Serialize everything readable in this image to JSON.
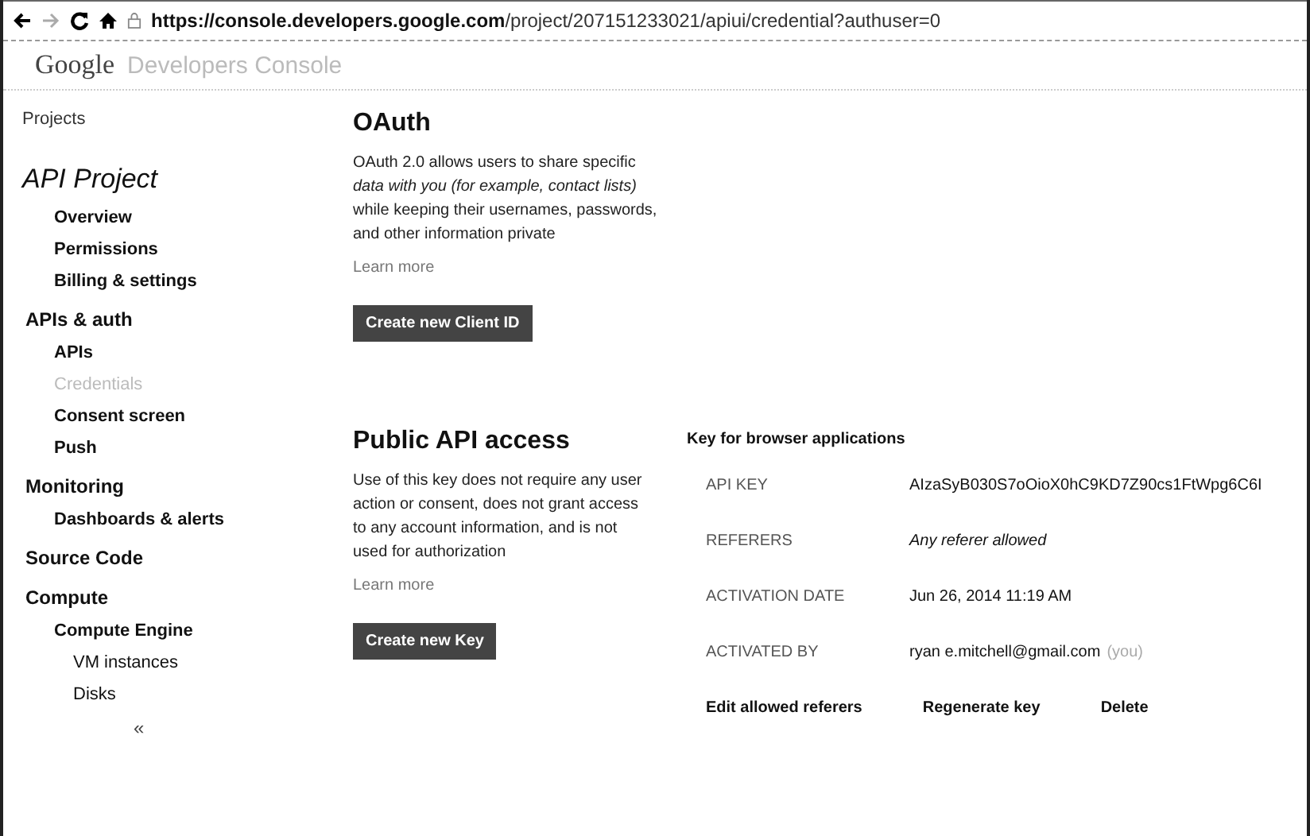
{
  "browser": {
    "url_host": "https://console.developers.google.com",
    "url_path": "/project/207151233021/apiui/credential?authuser=0"
  },
  "header": {
    "logo": "Google",
    "product": "Developers Console"
  },
  "sidebar": {
    "back_link": "Projects",
    "project": "API Project",
    "items": [
      {
        "label": "Overview",
        "kind": "item",
        "selected": false
      },
      {
        "label": "Permissions",
        "kind": "item",
        "selected": false
      },
      {
        "label": "Billing & settings",
        "kind": "item",
        "selected": false
      },
      {
        "label": "APIs & auth",
        "kind": "section",
        "selected": false
      },
      {
        "label": "APIs",
        "kind": "item",
        "selected": false
      },
      {
        "label": "Credentials",
        "kind": "item",
        "selected": true
      },
      {
        "label": "Consent screen",
        "kind": "item",
        "selected": false
      },
      {
        "label": "Push",
        "kind": "item",
        "selected": false
      },
      {
        "label": "Monitoring",
        "kind": "section",
        "selected": false
      },
      {
        "label": "Dashboards & alerts",
        "kind": "item",
        "selected": false
      },
      {
        "label": "Source Code",
        "kind": "section",
        "selected": false
      },
      {
        "label": "Compute",
        "kind": "section",
        "selected": false
      },
      {
        "label": "Compute Engine",
        "kind": "item",
        "selected": false
      },
      {
        "label": "VM instances",
        "kind": "subitem",
        "selected": false
      },
      {
        "label": "Disks",
        "kind": "subitem",
        "selected": false
      }
    ],
    "collapse": "«"
  },
  "oauth": {
    "title": "OAuth",
    "description": "OAuth 2.0 allows users to share specific *data with you (for example, contact lists)* while keeping their usernames, passwords, and other information private",
    "learn_more": "Learn more",
    "button": "Create new Client ID"
  },
  "public_api": {
    "title": "Public API access",
    "description": "Use of this key does not require any user action or consent, does not grant access to any account information, and is not used for authorization",
    "learn_more": "Learn more",
    "button": "Create new Key"
  },
  "key_card": {
    "title": "Key for browser applications",
    "fields": [
      {
        "label": "API KEY",
        "value": "AIzaSyB030S7oOioX0hC9KD7Z90cs1FtWpg6C6I",
        "kind": "plain"
      },
      {
        "label": "REFERERS",
        "value": "Any referer allowed",
        "kind": "italic"
      },
      {
        "label": "ACTIVATION DATE",
        "value": "Jun 26, 2014 11:19 AM",
        "kind": "plain"
      },
      {
        "label": "ACTIVATED BY",
        "value": "ryan e.mitchell@gmail.com",
        "note": "(you)",
        "kind": "plain"
      }
    ],
    "actions": [
      "Edit allowed referers",
      "Regenerate key",
      "Delete"
    ]
  }
}
